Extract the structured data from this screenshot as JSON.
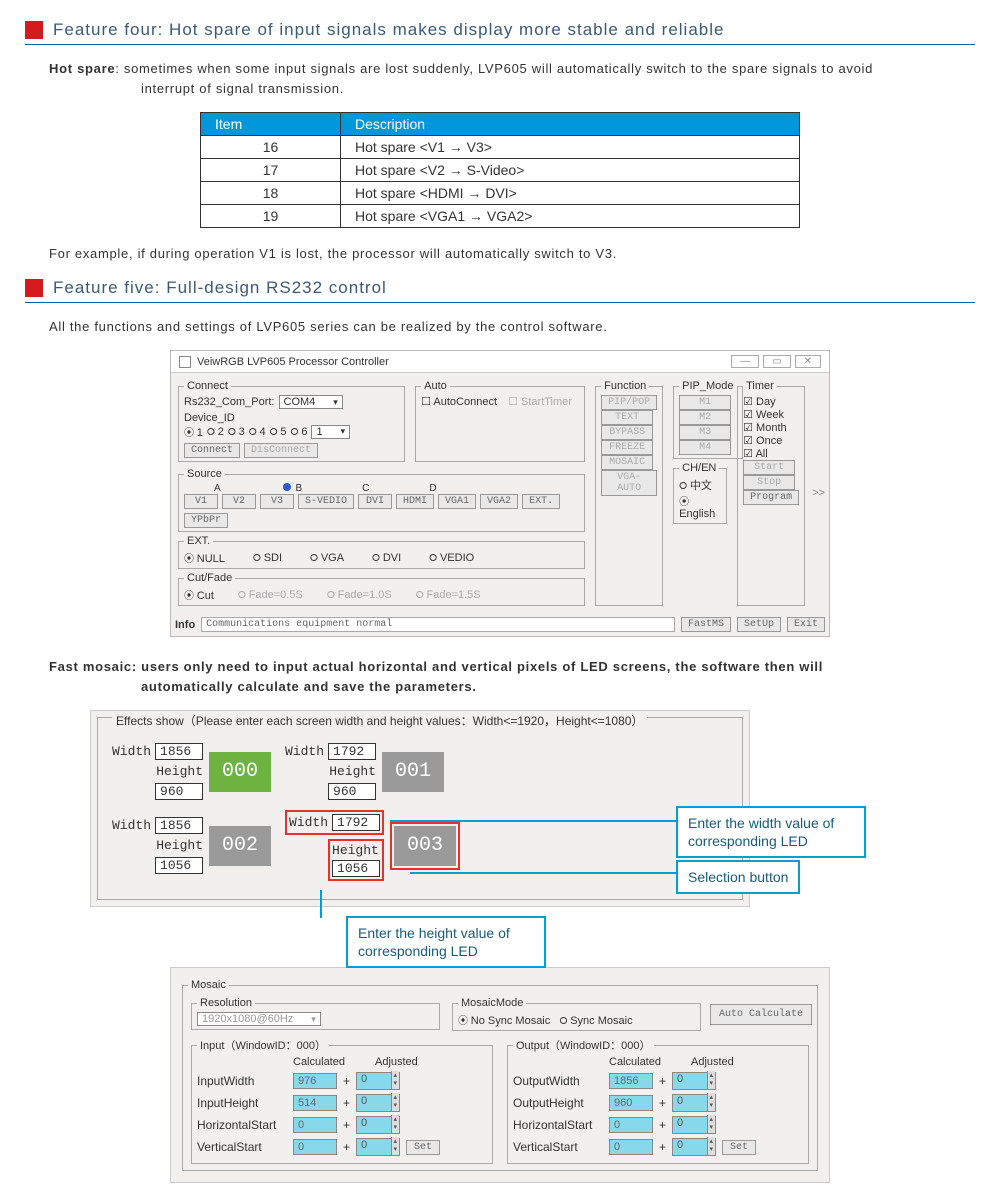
{
  "feature4": {
    "title": "Feature four: Hot spare of input signals makes display more stable and reliable",
    "intro_bold": "Hot spare",
    "intro_rest": ": sometimes when some input signals are lost suddenly, LVP605 will automatically switch to the spare signals to avoid",
    "intro_line2": "interrupt of signal transmission.",
    "table": {
      "headers": [
        "Item",
        "Description"
      ],
      "rows": [
        [
          "16",
          "Hot spare <V1 → V3>"
        ],
        [
          "17",
          "Hot spare <V2 → S-Video>"
        ],
        [
          "18",
          "Hot spare <HDMI → DVI>"
        ],
        [
          "19",
          "Hot spare <VGA1 → VGA2>"
        ]
      ]
    },
    "example": "For example, if during operation V1 is lost, the processor will automatically switch to V3."
  },
  "feature5": {
    "title": "Feature five: Full-design RS232 control",
    "intro": "All the functions and settings of LVP605 series can be realized by the control software."
  },
  "controller": {
    "title": "VeiwRGB LVP605 Processor Controller",
    "connect": {
      "legend": "Connect",
      "port_label": "Rs232_Com_Port:",
      "port": "COM4",
      "device_label": "Device_ID",
      "ids": [
        "1",
        "2",
        "3",
        "4",
        "5",
        "6"
      ],
      "id_combo": "1",
      "btn_connect": "Connect",
      "btn_disconnect": "DisConnect"
    },
    "auto": {
      "legend": "Auto",
      "chk_auto": "AutoConnect",
      "chk_timer": "StartTimer"
    },
    "source": {
      "legend": "Source",
      "groups": [
        "A",
        "B",
        "C",
        "D"
      ],
      "btns": [
        "V1",
        "V2",
        "V3",
        "S-VEDIO",
        "DVI",
        "HDMI",
        "VGA1",
        "VGA2",
        "EXT.",
        "YPbPr"
      ]
    },
    "ext": {
      "legend": "EXT.",
      "opts": [
        "NULL",
        "SDI",
        "VGA",
        "DVI",
        "VEDIO"
      ]
    },
    "cutfade": {
      "legend": "Cut/Fade",
      "opts": [
        "Cut",
        "Fade=0.5S",
        "Fade=1.0S",
        "Fade=1.5S"
      ]
    },
    "function": {
      "legend": "Function",
      "btns": [
        "PIP/POP",
        "TEXT",
        "BYPASS",
        "FREEZE",
        "MOSAIC",
        "VGA-AUTO"
      ]
    },
    "pip": {
      "legend": "PIP_Mode",
      "btns": [
        "M1",
        "M2",
        "M3",
        "M4"
      ]
    },
    "chen": {
      "legend": "CH/EN",
      "opts": [
        "中文",
        "English"
      ]
    },
    "timer": {
      "legend": "Timer",
      "chks": [
        "Day",
        "Week",
        "Month",
        "Once",
        "All"
      ],
      "btns": [
        "Start",
        "Stop",
        "Program"
      ]
    },
    "info_label": "Info",
    "info_text": "Communications equipment normal",
    "bottom_btns": [
      "FastMS",
      "SetUp",
      "Exit"
    ],
    "arrow": ">>"
  },
  "fastmosaic": {
    "bold": "Fast mosaic: users only need to input actual horizontal and vertical pixels of LED screens, the software then will",
    "line2": "automatically calculate and save the parameters.",
    "effects_title": "Effects show（Please enter each screen width and height values：Width<=1920，Height<=1080）",
    "w_label": "Width",
    "h_label": "Height",
    "screens": [
      {
        "w": "1856",
        "h": "960",
        "id": "000",
        "color": "green"
      },
      {
        "w": "1792",
        "h": "960",
        "id": "001",
        "color": "gray"
      },
      {
        "w": "1856",
        "h": "1056",
        "id": "002",
        "color": "gray"
      },
      {
        "w": "1792",
        "h": "1056",
        "id": "003",
        "color": "gray"
      }
    ],
    "call_width": "Enter the width value of corresponding LED",
    "call_sel": "Selection button",
    "call_height": "Enter the height value of corresponding LED"
  },
  "mosaic": {
    "legend": "Mosaic",
    "res_legend": "Resolution",
    "res": "1920x1080@60Hz",
    "mode_legend": "MosaicMode",
    "mode_opts": [
      "No Sync Mosaic",
      "Sync Mosaic"
    ],
    "auto_btn": "Auto Calculate",
    "input_legend": "Input（WindowID：000）",
    "output_legend": "Output（WindowID：000）",
    "col_calc": "Calculated",
    "col_adj": "Adjusted",
    "rows_in": [
      {
        "label": "InputWidth",
        "calc": "976",
        "adj": "0"
      },
      {
        "label": "InputHeight",
        "calc": "514",
        "adj": "0"
      },
      {
        "label": "HorizontalStart",
        "calc": "0",
        "adj": "0"
      },
      {
        "label": "VerticalStart",
        "calc": "0",
        "adj": "0"
      }
    ],
    "rows_out": [
      {
        "label": "OutputWidth",
        "calc": "1856",
        "adj": "0"
      },
      {
        "label": "OutputHeight",
        "calc": "960",
        "adj": "0"
      },
      {
        "label": "HorizontalStart",
        "calc": "0",
        "adj": "0"
      },
      {
        "label": "VerticalStart",
        "calc": "0",
        "adj": "0"
      }
    ],
    "set_btn": "Set"
  }
}
